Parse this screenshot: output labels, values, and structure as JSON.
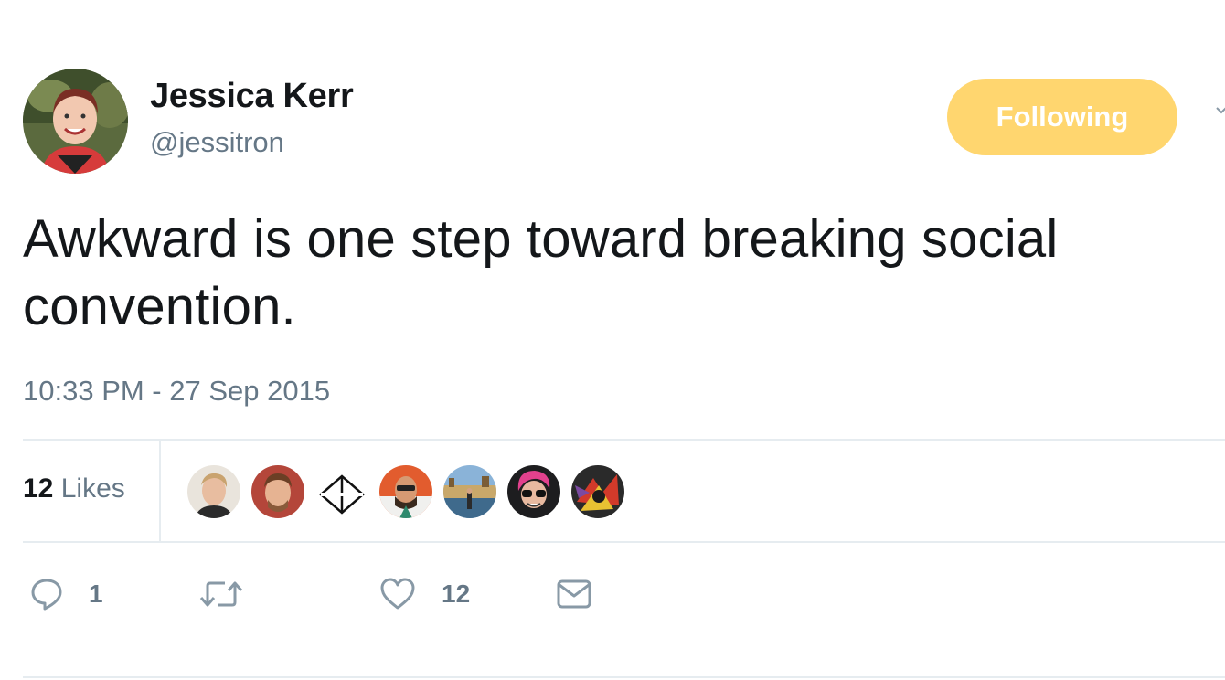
{
  "tweet": {
    "author": {
      "name": "Jessica Kerr",
      "handle": "@jessitron"
    },
    "follow_label": "Following",
    "text": "Awkward is one step toward breaking social\nconvention.",
    "timestamp": "10:33 PM - 27 Sep 2015",
    "stats": {
      "likes_count": "12",
      "likes_label": "Likes"
    },
    "likers": [
      {
        "icon": "liker-avatar-1"
      },
      {
        "icon": "liker-avatar-2"
      },
      {
        "icon": "liker-avatar-3"
      },
      {
        "icon": "liker-avatar-4"
      },
      {
        "icon": "liker-avatar-5"
      },
      {
        "icon": "liker-avatar-6"
      },
      {
        "icon": "liker-avatar-7"
      }
    ],
    "actions": {
      "reply": {
        "icon": "reply-icon",
        "count": "1"
      },
      "retweet": {
        "icon": "retweet-icon"
      },
      "like": {
        "icon": "heart-icon",
        "count": "12"
      },
      "dm": {
        "icon": "envelope-icon"
      }
    }
  },
  "colors": {
    "follow_button_bg": "#ffd66f",
    "secondary_text": "#657786",
    "primary_text": "#14171a",
    "divider": "#e6ecf0"
  }
}
